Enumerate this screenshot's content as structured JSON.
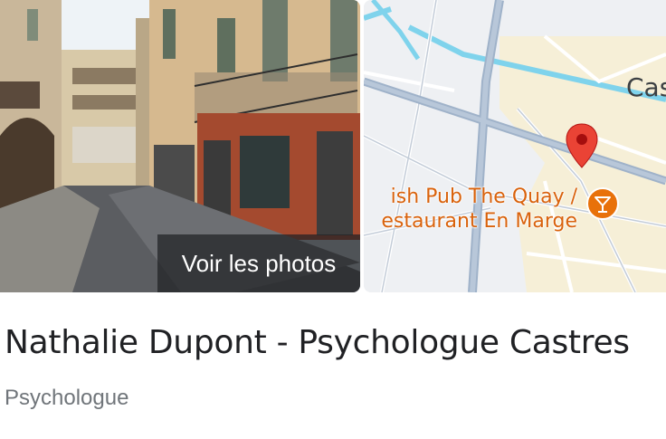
{
  "photo": {
    "button_label": "Voir les photos"
  },
  "map": {
    "town_label": "Cas",
    "poi": {
      "label_line1": "ish Pub The Quay /",
      "label_line2": "estaurant En Marge",
      "icon": "cocktail-glass-icon",
      "color": "#e8710a"
    },
    "pin": {
      "icon": "map-pin-icon",
      "color": "#ea4335"
    },
    "river_color": "#7fd3ec",
    "road_color": "#9fb2c9"
  },
  "place": {
    "name": "Nathalie Dupont - Psychologue Castres",
    "category": "Psychologue"
  }
}
